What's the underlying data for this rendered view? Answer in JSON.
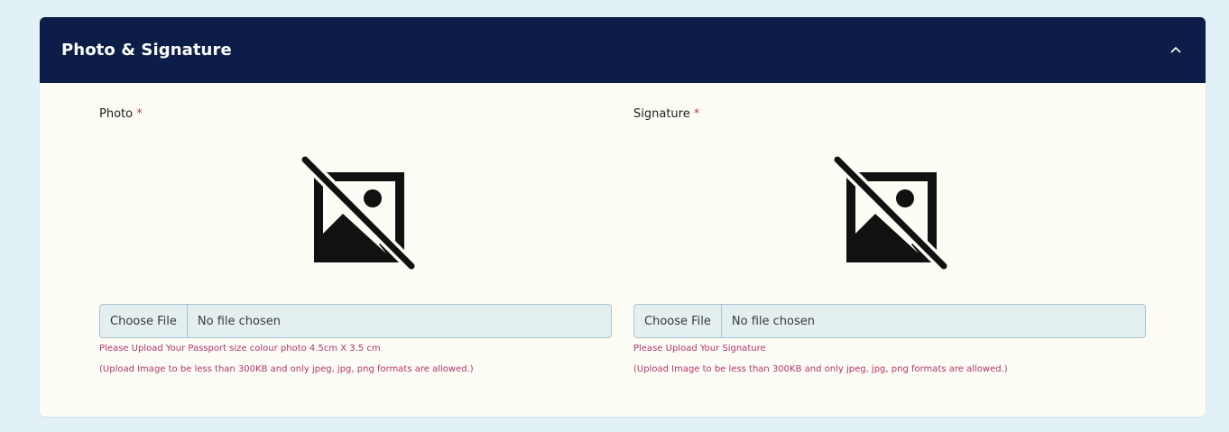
{
  "section": {
    "title": "Photo & Signature",
    "collapse_icon": "chevron-up-icon"
  },
  "photo": {
    "label": "Photo",
    "required_mark": "*",
    "preview_icon": "image-off-icon",
    "choose_label": "Choose File",
    "status": "No file chosen",
    "hint_line1": "Please Upload Your Passport size colour photo 4.5cm X 3.5 cm",
    "hint_line2": "(Upload Image to be less than 300KB and only jpeg, jpg, png formats are allowed.)"
  },
  "signature": {
    "label": "Signature",
    "required_mark": "*",
    "preview_icon": "image-off-icon",
    "choose_label": "Choose File",
    "status": "No file chosen",
    "hint_line1": "Please Upload Your Signature",
    "hint_line2": "(Upload Image to be less than 300KB and only jpeg, jpg, png formats are allowed.)"
  },
  "colors": {
    "header_bg": "#0c1d48",
    "card_bg": "#fdfdf5",
    "page_bg": "#e2f1f6",
    "required": "#c0394b",
    "hint": "#b5336b",
    "input_bg": "#e4eff0"
  }
}
